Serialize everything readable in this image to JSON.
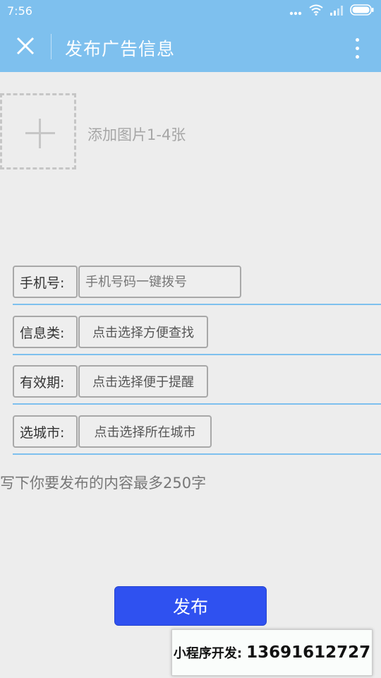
{
  "status_bar": {
    "time": "7:56",
    "icons": [
      "more-dots-icon",
      "wifi-icon",
      "signal-icon",
      "battery-icon"
    ]
  },
  "nav": {
    "title": "发布广告信息",
    "close_icon": "close-icon",
    "more_icon": "more-vertical-icon",
    "bg_color": "#7ec0ee"
  },
  "upload": {
    "label": "添加图片1-4张",
    "icon": "plus-icon"
  },
  "form": {
    "phone": {
      "label": "手机号:",
      "placeholder": "手机号码一键拨号"
    },
    "category": {
      "label": "信息类:",
      "value": "点击选择方便查找"
    },
    "validity": {
      "label": "有效期:",
      "value": "点击选择便于提醒"
    },
    "city": {
      "label": "选城市:",
      "value": "点击选择所在城市"
    }
  },
  "content": {
    "placeholder": "写下你要发布的内容最多250字"
  },
  "publish": {
    "label": "发布",
    "color": "#2f51f0"
  },
  "contact": {
    "label": "小程序开发:",
    "phone": "13691612727"
  }
}
